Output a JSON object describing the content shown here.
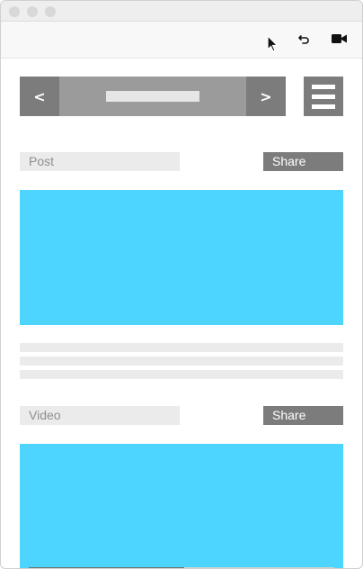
{
  "window": {
    "controls": [
      "close",
      "minimize",
      "zoom"
    ]
  },
  "toolbar": {
    "undo_icon": "undo-icon",
    "video_icon": "video-camera-icon"
  },
  "nav": {
    "prev_label": "<",
    "next_label": ">",
    "menu_icon": "hamburger-menu-icon"
  },
  "sections": [
    {
      "label": "Post",
      "share_label": "Share"
    },
    {
      "label": "Video",
      "share_label": "Share",
      "progress": 0.51
    }
  ],
  "colors": {
    "accent": "#4dd5ff",
    "dark_gray": "#7c7c7c",
    "mid_gray": "#9b9b9b",
    "light_gray": "#ebebeb"
  }
}
